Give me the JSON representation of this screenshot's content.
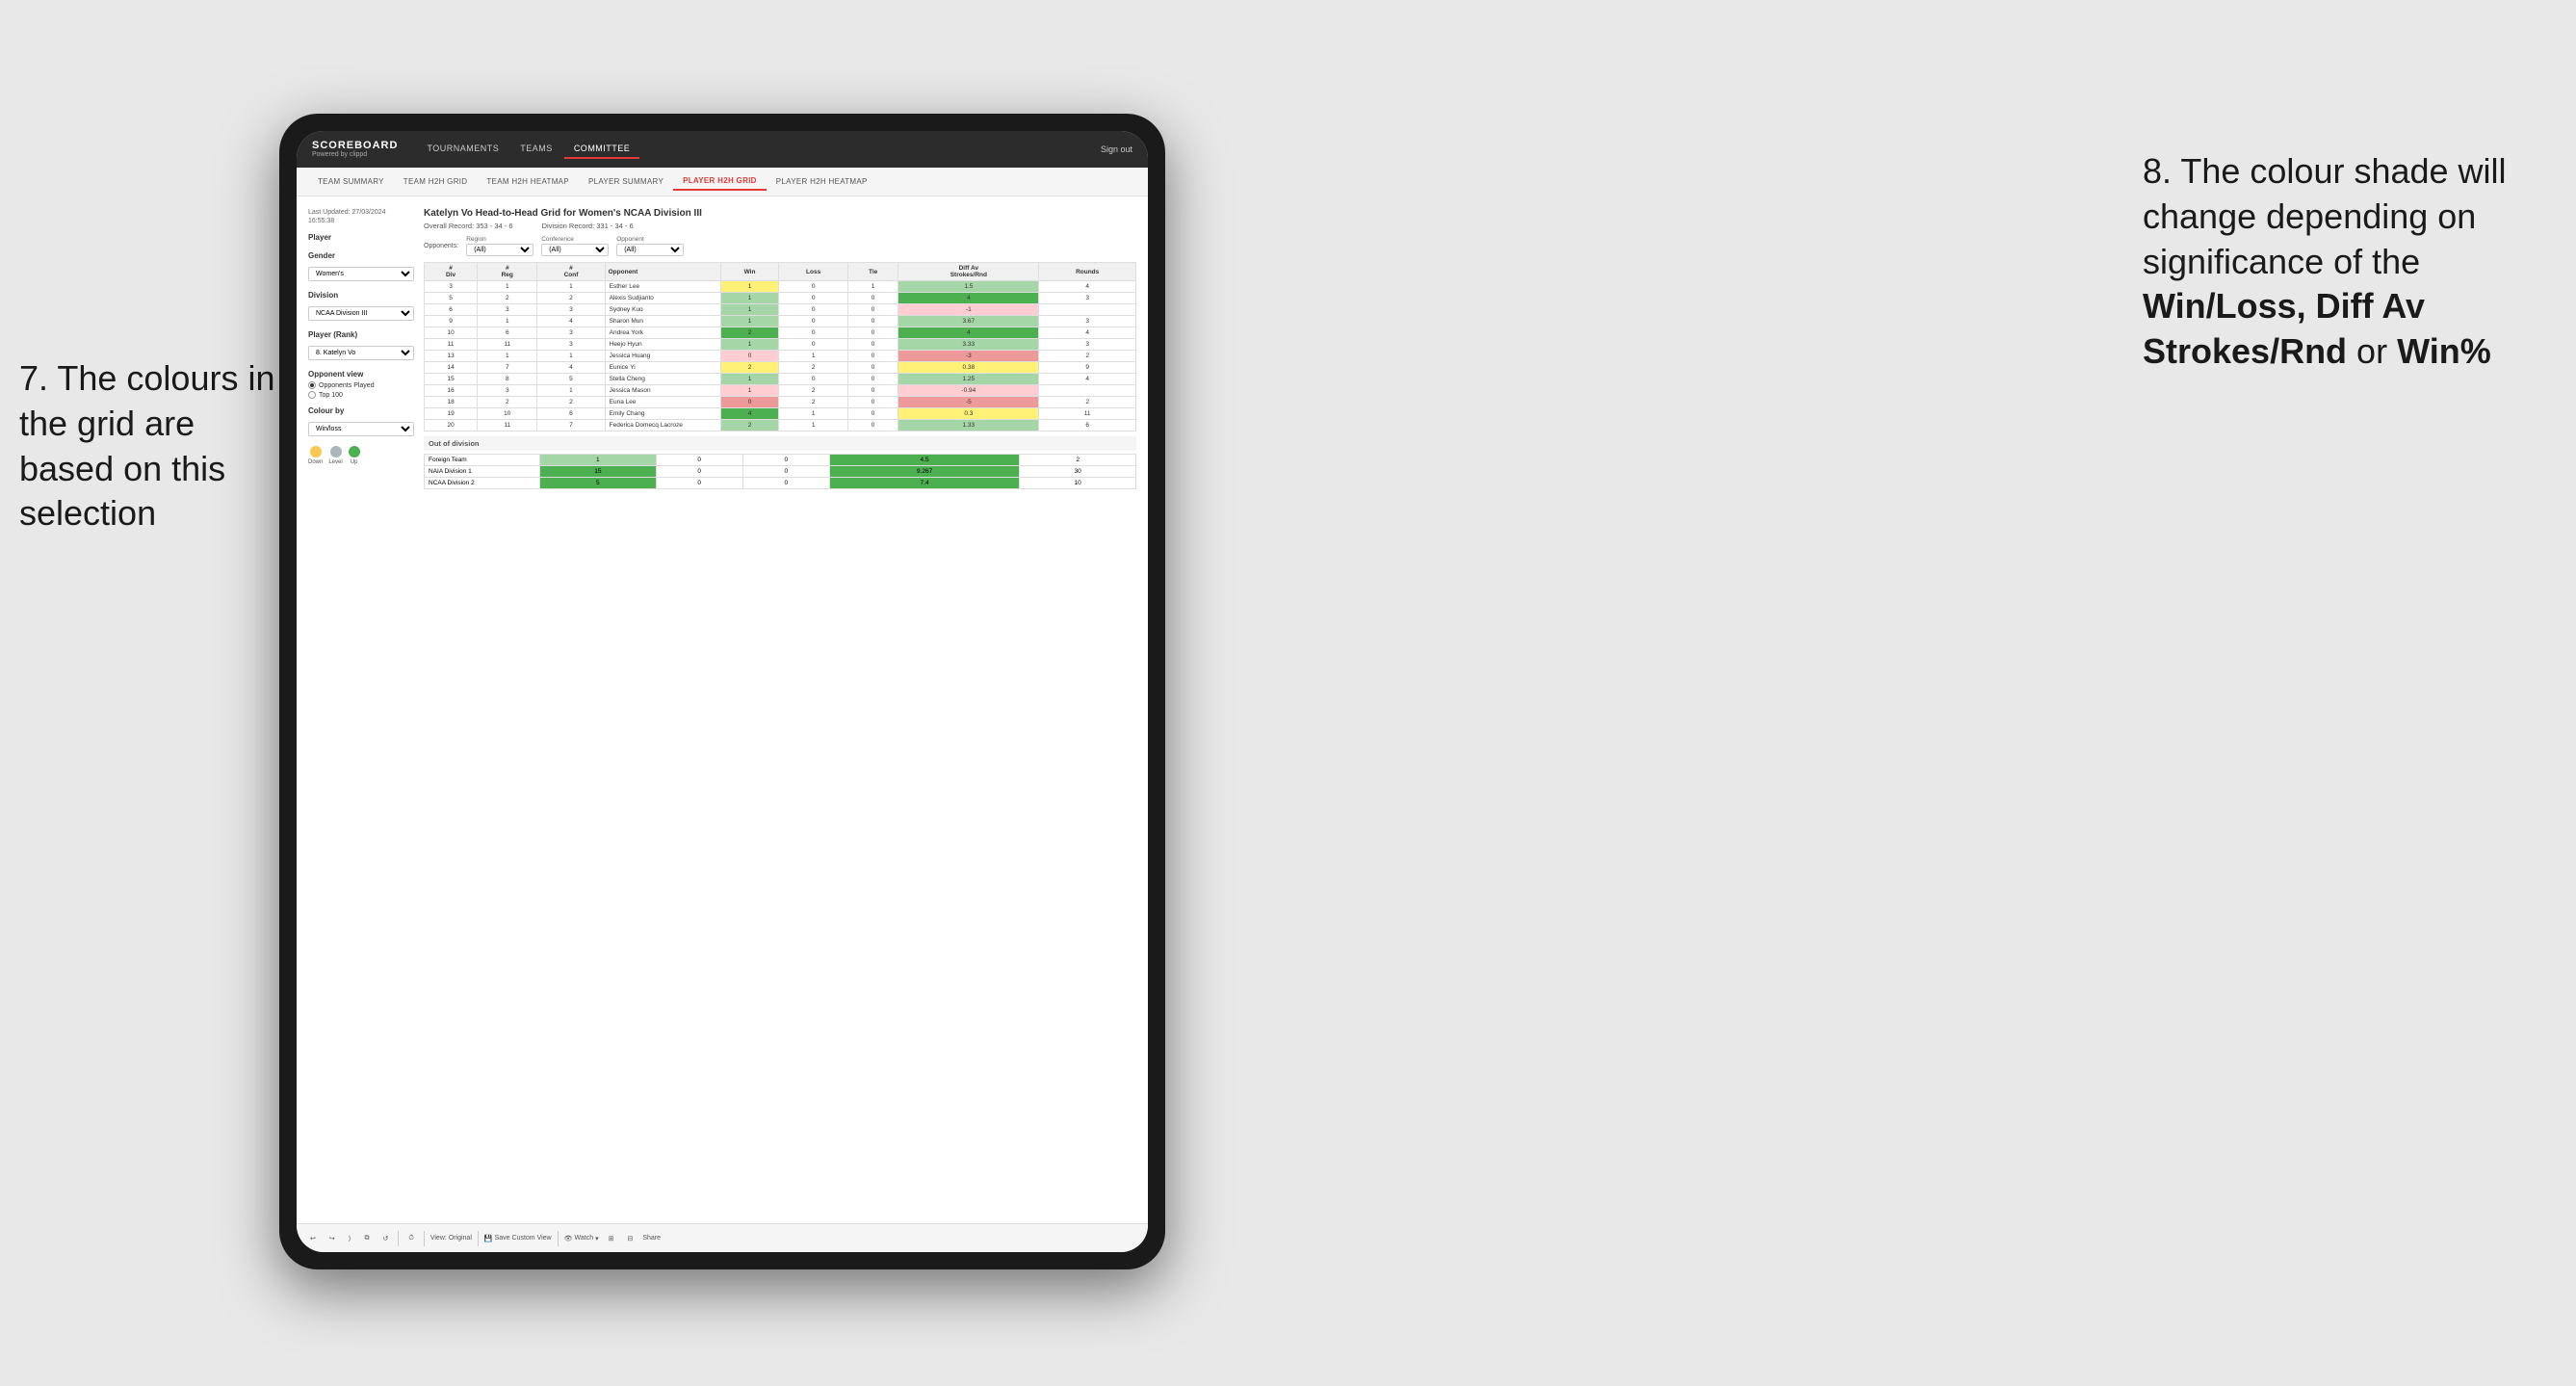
{
  "annotations": {
    "left_title": "7. The colours in the grid are based on this selection",
    "right_title": "8. The colour shade will change depending on significance of the",
    "right_bold1": "Win/Loss, Diff Av Strokes/Rnd",
    "right_or": " or ",
    "right_bold2": "Win%"
  },
  "nav": {
    "logo": "SCOREBOARD",
    "logo_sub": "Powered by clippd",
    "items": [
      "TOURNAMENTS",
      "TEAMS",
      "COMMITTEE"
    ],
    "active": "COMMITTEE",
    "sign_out": "Sign out"
  },
  "sub_nav": {
    "items": [
      "TEAM SUMMARY",
      "TEAM H2H GRID",
      "TEAM H2H HEATMAP",
      "PLAYER SUMMARY",
      "PLAYER H2H GRID",
      "PLAYER H2H HEATMAP"
    ],
    "active": "PLAYER H2H GRID"
  },
  "sidebar": {
    "last_updated_label": "Last Updated: 27/03/2024",
    "last_updated_time": "16:55:38",
    "player_label": "Player",
    "gender_label": "Gender",
    "gender_value": "Women's",
    "division_label": "Division",
    "division_value": "NCAA Division III",
    "player_rank_label": "Player (Rank)",
    "player_rank_value": "8. Katelyn Vo",
    "opponent_view_label": "Opponent view",
    "radio1": "Opponents Played",
    "radio2": "Top 100",
    "colour_by_label": "Colour by",
    "colour_by_value": "Win/loss",
    "legend": {
      "down_label": "Down",
      "level_label": "Level",
      "up_label": "Up",
      "down_color": "#f9c74f",
      "level_color": "#adb5bd",
      "up_color": "#4caf50"
    }
  },
  "grid": {
    "title": "Katelyn Vo Head-to-Head Grid for Women's NCAA Division III",
    "overall_record_label": "Overall Record:",
    "overall_record": "353 - 34 - 6",
    "division_record_label": "Division Record:",
    "division_record": "331 - 34 - 6",
    "opponents_label": "Opponents:",
    "region_label": "Region",
    "region_value": "(All)",
    "conference_label": "Conference",
    "conference_value": "(All)",
    "opponent_label": "Opponent",
    "opponent_value": "(All)",
    "columns": {
      "div": "#\nDiv",
      "reg": "#\nReg",
      "conf": "#\nConf",
      "opponent": "Opponent",
      "win": "Win",
      "loss": "Loss",
      "tie": "Tie",
      "diff_av": "Diff Av\nStrokes/Rnd",
      "rounds": "Rounds"
    },
    "rows": [
      {
        "div": 3,
        "reg": 1,
        "conf": 1,
        "opponent": "Esther Lee",
        "win": 1,
        "loss": 0,
        "tie": 1,
        "diff": 1.5,
        "rounds": 4,
        "win_color": "yellow",
        "diff_color": "green-light"
      },
      {
        "div": 5,
        "reg": 2,
        "conf": 2,
        "opponent": "Alexis Sudjianto",
        "win": 1,
        "loss": 0,
        "tie": 0,
        "diff": 4.0,
        "rounds": 3,
        "win_color": "green-light",
        "diff_color": "green-dark"
      },
      {
        "div": 6,
        "reg": 3,
        "conf": 3,
        "opponent": "Sydney Kuo",
        "win": 1,
        "loss": 0,
        "tie": 0,
        "diff": -1.0,
        "rounds": "",
        "win_color": "green-light",
        "diff_color": "red-light"
      },
      {
        "div": 9,
        "reg": 1,
        "conf": 4,
        "opponent": "Sharon Mun",
        "win": 1,
        "loss": 0,
        "tie": 0,
        "diff": 3.67,
        "rounds": 3,
        "win_color": "green-light",
        "diff_color": "green-light"
      },
      {
        "div": 10,
        "reg": 6,
        "conf": 3,
        "opponent": "Andrea York",
        "win": 2,
        "loss": 0,
        "tie": 0,
        "diff": 4.0,
        "rounds": 4,
        "win_color": "green-dark",
        "diff_color": "green-dark"
      },
      {
        "div": 11,
        "reg": 11,
        "conf": 3,
        "opponent": "Heejo Hyun",
        "win": 1,
        "loss": 0,
        "tie": 0,
        "diff": 3.33,
        "rounds": 3,
        "win_color": "green-light",
        "diff_color": "green-light"
      },
      {
        "div": 13,
        "reg": 1,
        "conf": 1,
        "opponent": "Jessica Huang",
        "win": 0,
        "loss": 1,
        "tie": 0,
        "diff": -3.0,
        "rounds": 2,
        "win_color": "red-light",
        "diff_color": "red-dark"
      },
      {
        "div": 14,
        "reg": 7,
        "conf": 4,
        "opponent": "Eunice Yi",
        "win": 2,
        "loss": 2,
        "tie": 0,
        "diff": 0.38,
        "rounds": 9,
        "win_color": "yellow",
        "diff_color": "yellow"
      },
      {
        "div": 15,
        "reg": 8,
        "conf": 5,
        "opponent": "Stella Cheng",
        "win": 1,
        "loss": 0,
        "tie": 0,
        "diff": 1.25,
        "rounds": 4,
        "win_color": "green-light",
        "diff_color": "green-light"
      },
      {
        "div": 16,
        "reg": 3,
        "conf": 1,
        "opponent": "Jessica Mason",
        "win": 1,
        "loss": 2,
        "tie": 0,
        "diff": -0.94,
        "rounds": "",
        "win_color": "red-light",
        "diff_color": "red-light"
      },
      {
        "div": 18,
        "reg": 2,
        "conf": 2,
        "opponent": "Euna Lee",
        "win": 0,
        "loss": 2,
        "tie": 0,
        "diff": -5.0,
        "rounds": 2,
        "win_color": "red-dark",
        "diff_color": "red-dark"
      },
      {
        "div": 19,
        "reg": 10,
        "conf": 6,
        "opponent": "Emily Chang",
        "win": 4,
        "loss": 1,
        "tie": 0,
        "diff": 0.3,
        "rounds": 11,
        "win_color": "green-dark",
        "diff_color": "yellow"
      },
      {
        "div": 20,
        "reg": 11,
        "conf": 7,
        "opponent": "Federica Domecq Lacroze",
        "win": 2,
        "loss": 1,
        "tie": 0,
        "diff": 1.33,
        "rounds": 6,
        "win_color": "green-light",
        "diff_color": "green-light"
      }
    ],
    "out_of_division_label": "Out of division",
    "out_of_div_rows": [
      {
        "team": "Foreign Team",
        "win": 1,
        "loss": 0,
        "tie": 0,
        "diff": 4.5,
        "rounds": 2,
        "win_color": "green-light",
        "diff_color": "green-dark"
      },
      {
        "team": "NAIA Division 1",
        "win": 15,
        "loss": 0,
        "tie": 0,
        "diff": 9.267,
        "rounds": 30,
        "win_color": "green-dark",
        "diff_color": "green-dark"
      },
      {
        "team": "NCAA Division 2",
        "win": 5,
        "loss": 0,
        "tie": 0,
        "diff": 7.4,
        "rounds": 10,
        "win_color": "green-dark",
        "diff_color": "green-dark"
      }
    ]
  },
  "toolbar": {
    "view_original": "View: Original",
    "save_custom": "Save Custom View",
    "watch": "Watch",
    "share": "Share"
  }
}
